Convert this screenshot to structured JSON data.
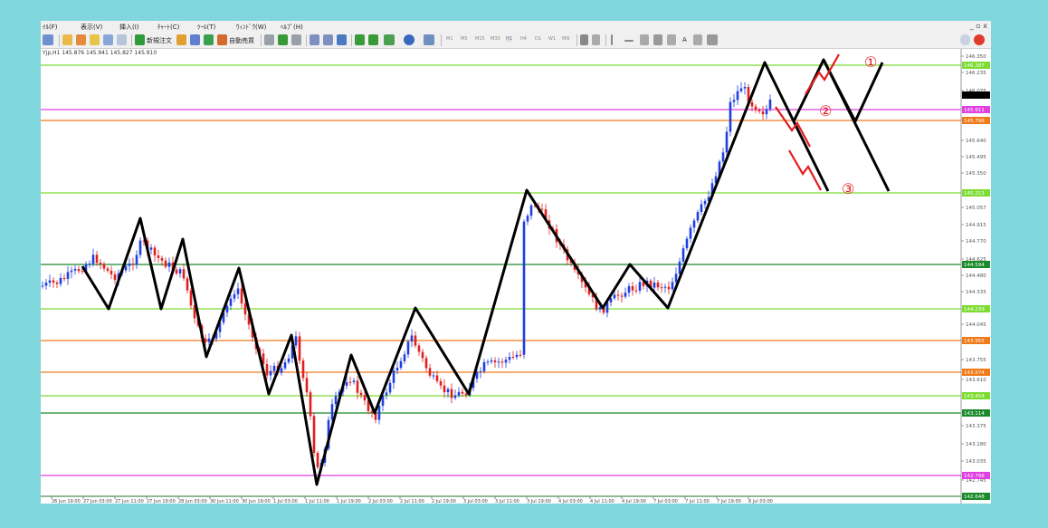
{
  "menu": [
    "ｲﾙ(F)",
    "表示(V)",
    "挿入(I)",
    "ﾁｬｰﾄ(C)",
    "ﾂｰﾙ(T)",
    "ｳｨﾝﾄﾞｳ(W)",
    "ﾍﾙﾌﾟ(H)"
  ],
  "window_controls": "_ ▫ x",
  "toolbar": {
    "new_order": "新規注文",
    "auto_trade": "自動売買",
    "timeframes": [
      "M1",
      "M5",
      "M15",
      "M30",
      "H1",
      "H4",
      "D1",
      "W1",
      "MN"
    ],
    "text_tool": "A"
  },
  "chart_info": "Yjp,H1  145.876 145.941 145.827 145.910",
  "price_labels": [
    "146.350",
    "146.235",
    "146.075",
    "145.910",
    "145.785",
    "145.640",
    "145.495",
    "145.350",
    "145.057",
    "144.915",
    "144.770",
    "144.625",
    "144.480",
    "144.335",
    "144.045",
    "143.900",
    "143.755",
    "143.610",
    "143.375",
    "143.180",
    "143.035",
    "142.745"
  ],
  "level_labels": [
    "146.387",
    "145.911",
    "145.798",
    "145.213",
    "144.594",
    "144.239",
    "143.955",
    "143.574",
    "143.454",
    "143.114",
    "142.798",
    "142.648"
  ],
  "time_labels": [
    "26 Jun 19:00",
    "27 Jun 03:00",
    "27 Jun 11:00",
    "27 Jun 19:00",
    "28 Jun 03:00",
    "30 Jun 11:00",
    "30 Jun 19:00",
    "1 Jul 03:00",
    "1 Jul 11:00",
    "1 Jul 19:00",
    "2 Jul 03:00",
    "2 Jul 11:00",
    "2 Jul 19:00",
    "3 Jul 03:00",
    "3 Jul 11:00",
    "3 Jul 19:00",
    "4 Jul 03:00",
    "4 Jul 11:00",
    "4 Jul 19:00",
    "7 Jul 03:00",
    "7 Jul 11:00",
    "7 Jul 19:00",
    "8 Jul 03:00"
  ],
  "annotations": [
    "①",
    "②",
    "③"
  ],
  "colors": {
    "background": "#7fd6dc",
    "bull": "#1f3fe0",
    "bear": "#e01f1f",
    "zigzag": "#000000",
    "arrow": "#e41b1b",
    "lime": "#7cdc32",
    "orange": "#f07a1a",
    "magenta": "#e040e0",
    "green": "#1a8a2a"
  }
}
